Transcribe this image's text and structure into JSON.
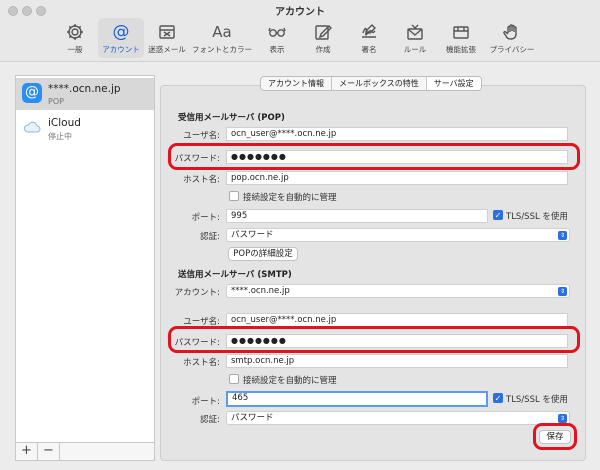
{
  "window": {
    "title": "アカウント"
  },
  "toolbar": {
    "items": [
      {
        "label": "一般",
        "icon": "gear-icon"
      },
      {
        "label": "アカウント",
        "icon": "at-sign-icon"
      },
      {
        "label": "迷惑メール",
        "icon": "junk-tray-icon"
      },
      {
        "label": "フォントとカラー",
        "icon": "font-aa-icon",
        "glyph": "Aa"
      },
      {
        "label": "表示",
        "icon": "glasses-icon"
      },
      {
        "label": "作成",
        "icon": "compose-icon"
      },
      {
        "label": "署名",
        "icon": "signature-icon"
      },
      {
        "label": "ルール",
        "icon": "rules-envelope-icon"
      },
      {
        "label": "機能拡張",
        "icon": "extensions-icon"
      },
      {
        "label": "プライバシー",
        "icon": "hand-icon"
      }
    ],
    "at_glyph": "@"
  },
  "sidebar": {
    "accounts": [
      {
        "name": "****.ocn.ne.jp",
        "sub": "POP",
        "icon": "at-mail-account-icon"
      },
      {
        "name": "iCloud",
        "sub": "停止中",
        "icon": "icloud-icon"
      }
    ],
    "add_label": "+",
    "remove_label": "−"
  },
  "tabs": [
    "アカウント情報",
    "メールボックスの特性",
    "サーバ設定"
  ],
  "incoming": {
    "title": "受信用メールサーバ (POP)",
    "username_label": "ユーザ名:",
    "username": "ocn_user@****.ocn.ne.jp",
    "password_label": "パスワード:",
    "password": "●●●●●●●",
    "host_label": "ホスト名:",
    "host": "pop.ocn.ne.jp",
    "auto_manage_label": "接続設定を自動的に管理",
    "port_label": "ポート:",
    "port": "995",
    "tls_label": "TLS/SSL を使用",
    "auth_label": "認証:",
    "auth": "パスワード",
    "advanced_button": "POPの詳細設定"
  },
  "outgoing": {
    "title": "送信用メールサーバ (SMTP)",
    "account_label": "アカウント:",
    "account": "****.ocn.ne.jp",
    "username_label": "ユーザ名:",
    "username": "ocn_user@****.ocn.ne.jp",
    "password_label": "パスワード:",
    "password": "●●●●●●●",
    "host_label": "ホスト名:",
    "host": "smtp.ocn.ne.jp",
    "auto_manage_label": "接続設定を自動的に管理",
    "port_label": "ポート:",
    "port": "465",
    "tls_label": "TLS/SSL を使用",
    "auth_label": "認証:",
    "auth": "パスワード"
  },
  "save_button": "保存",
  "colors": {
    "accent": "#2c6fe0",
    "highlight": "#e0141e",
    "selected_tab_text": "#1a62d6"
  }
}
